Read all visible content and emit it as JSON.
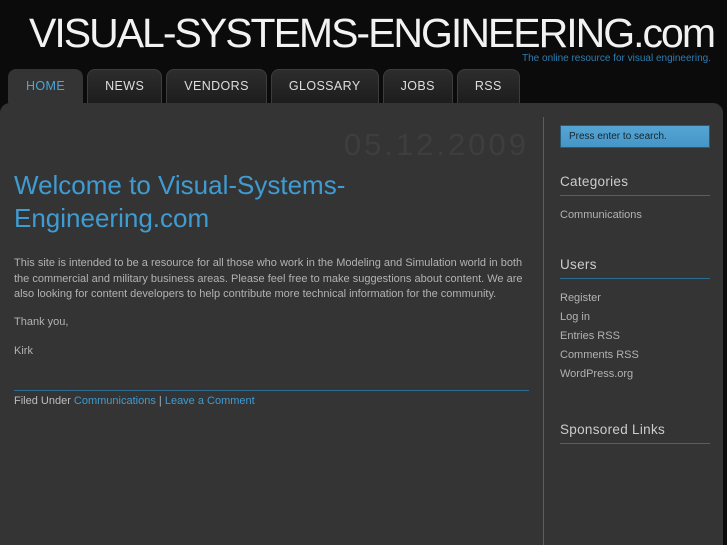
{
  "site": {
    "title": "VISUAL-SYSTEMS-ENGINEERING.com",
    "tagline": "The online resource for visual engineering."
  },
  "nav": {
    "tabs": [
      {
        "label": "HOME",
        "active": true
      },
      {
        "label": "NEWS",
        "active": false
      },
      {
        "label": "VENDORS",
        "active": false
      },
      {
        "label": "GLOSSARY",
        "active": false
      },
      {
        "label": "JOBS",
        "active": false
      },
      {
        "label": "RSS",
        "active": false
      }
    ]
  },
  "post": {
    "date": "05.12.2009",
    "title": "Welcome to Visual-Systems-\nEngineering.com",
    "body": "This site is intended to be a resource for all those who work in the Modeling and Simulation world in both\nthe commercial and military business areas. Please feel free to make suggestions about content. We are\nalso looking for content developers to help contribute more technical information for the community.",
    "thanks": "Thank you,",
    "signature": "Kirk",
    "footer": {
      "filed_under_label": "Filed Under",
      "category_link": "Communications",
      "separator": "|",
      "comment_link": "Leave a Comment"
    }
  },
  "sidebar": {
    "search": {
      "placeholder": "Press enter to search."
    },
    "sections": [
      {
        "heading": "Categories",
        "links": [
          "Communications"
        ]
      },
      {
        "heading": "Users",
        "links": [
          "Register",
          "Log in",
          "Entries RSS",
          "Comments RSS",
          "WordPress.org"
        ]
      },
      {
        "heading": "Sponsored Links",
        "links": []
      }
    ]
  },
  "colors": {
    "page_bg": "#0b0b0b",
    "panel_bg": "#343434",
    "accent_blue": "#4aa6d8",
    "link_blue": "#3e9bd3",
    "divider_blue": "#2d6b91",
    "tagline_blue": "#2f7cb2",
    "search_bg": "#4a9dce",
    "body_text": "#b2b2b2",
    "date_watermark": "#3e3e3e"
  }
}
